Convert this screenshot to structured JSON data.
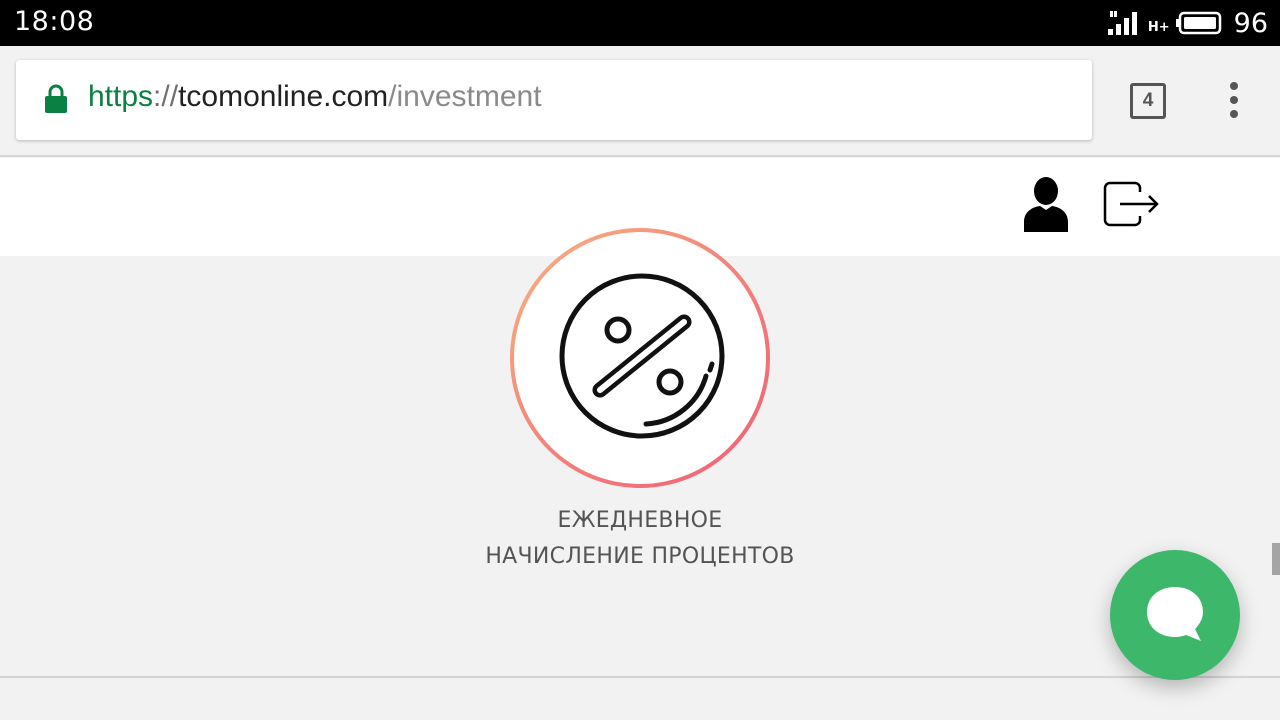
{
  "status_bar": {
    "time": "18:08",
    "network_type": "H+",
    "battery_level": "96"
  },
  "browser": {
    "url": {
      "scheme": "https",
      "separator": "://",
      "host": "tcomonline.com",
      "path": "/investment"
    },
    "tab_count": "4",
    "accent_color": "#0b8043"
  },
  "site_header": {
    "icons": [
      "user-icon",
      "logout-icon"
    ]
  },
  "feature": {
    "icon": "percent-icon",
    "title_line1": "ЕЖЕДНЕВНОЕ",
    "title_line2": "НАЧИСЛЕНИЕ ПРОЦЕНТОВ",
    "ring_colors": [
      "#f6b483",
      "#ef5f77"
    ]
  },
  "chat": {
    "icon": "chat-bubble-icon",
    "color": "#3db86b"
  }
}
